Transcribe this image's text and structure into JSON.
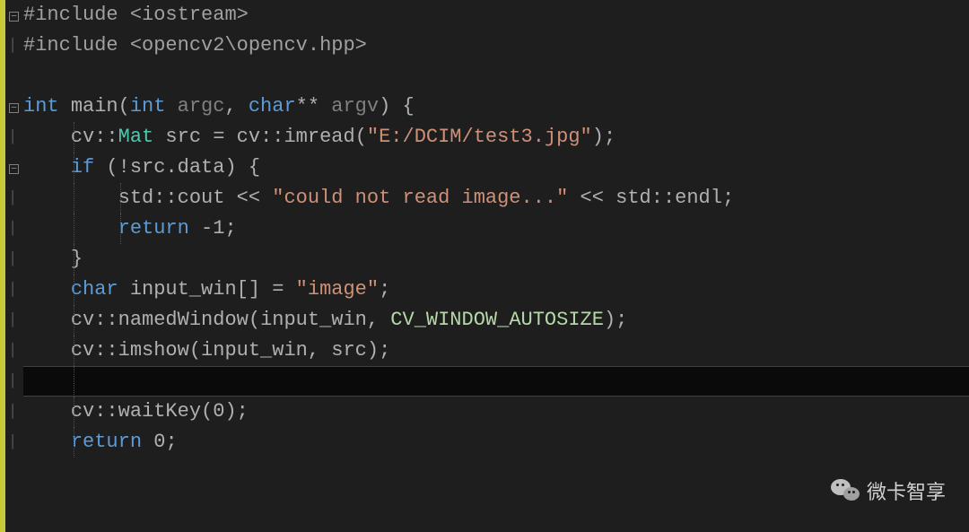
{
  "code": {
    "lines": [
      {
        "fold": "collapse",
        "indent": 0,
        "segments": [
          {
            "cls": "preprocessor",
            "text": "#include "
          },
          {
            "cls": "include-path",
            "text": "<iostream>"
          }
        ]
      },
      {
        "fold": "pipe",
        "indent": 0,
        "segments": [
          {
            "cls": "preprocessor",
            "text": "#include "
          },
          {
            "cls": "include-path",
            "text": "<opencv2\\opencv.hpp>"
          }
        ]
      },
      {
        "fold": "",
        "indent": 0,
        "segments": []
      },
      {
        "fold": "collapse",
        "indent": 0,
        "segments": [
          {
            "cls": "keyword-type",
            "text": "int"
          },
          {
            "cls": "punct",
            "text": " "
          },
          {
            "cls": "identifier",
            "text": "main"
          },
          {
            "cls": "paren",
            "text": "("
          },
          {
            "cls": "keyword-type",
            "text": "int"
          },
          {
            "cls": "param",
            "text": " argc"
          },
          {
            "cls": "punct",
            "text": ", "
          },
          {
            "cls": "keyword-type",
            "text": "char"
          },
          {
            "cls": "operator",
            "text": "**"
          },
          {
            "cls": "param",
            "text": " argv"
          },
          {
            "cls": "paren",
            "text": ") "
          },
          {
            "cls": "punct",
            "text": "{"
          }
        ]
      },
      {
        "fold": "pipe",
        "indent": 1,
        "segments": [
          {
            "cls": "namespace",
            "text": "cv"
          },
          {
            "cls": "punct",
            "text": "::"
          },
          {
            "cls": "class-name",
            "text": "Mat"
          },
          {
            "cls": "identifier",
            "text": " src "
          },
          {
            "cls": "operator",
            "text": "="
          },
          {
            "cls": "identifier",
            "text": " cv"
          },
          {
            "cls": "punct",
            "text": "::"
          },
          {
            "cls": "func",
            "text": "imread"
          },
          {
            "cls": "paren",
            "text": "("
          },
          {
            "cls": "string",
            "text": "\"E:/DCIM/test3.jpg\""
          },
          {
            "cls": "paren",
            "text": ")"
          },
          {
            "cls": "punct",
            "text": ";"
          }
        ]
      },
      {
        "fold": "collapse-nested",
        "indent": 1,
        "segments": [
          {
            "cls": "keyword",
            "text": "if"
          },
          {
            "cls": "punct",
            "text": " "
          },
          {
            "cls": "paren",
            "text": "("
          },
          {
            "cls": "operator",
            "text": "!"
          },
          {
            "cls": "identifier",
            "text": "src"
          },
          {
            "cls": "punct",
            "text": "."
          },
          {
            "cls": "identifier",
            "text": "data"
          },
          {
            "cls": "paren",
            "text": ")"
          },
          {
            "cls": "punct",
            "text": " {"
          }
        ]
      },
      {
        "fold": "pipe-nested",
        "indent": 2,
        "segments": [
          {
            "cls": "namespace",
            "text": "std"
          },
          {
            "cls": "punct",
            "text": "::"
          },
          {
            "cls": "identifier",
            "text": "cout "
          },
          {
            "cls": "operator",
            "text": "<<"
          },
          {
            "cls": "punct",
            "text": " "
          },
          {
            "cls": "string",
            "text": "\"could not read image...\""
          },
          {
            "cls": "punct",
            "text": " "
          },
          {
            "cls": "operator",
            "text": "<<"
          },
          {
            "cls": "punct",
            "text": " "
          },
          {
            "cls": "namespace",
            "text": "std"
          },
          {
            "cls": "punct",
            "text": "::"
          },
          {
            "cls": "identifier",
            "text": "endl"
          },
          {
            "cls": "punct",
            "text": ";"
          }
        ]
      },
      {
        "fold": "pipe-nested",
        "indent": 2,
        "segments": [
          {
            "cls": "keyword",
            "text": "return"
          },
          {
            "cls": "punct",
            "text": " "
          },
          {
            "cls": "operator",
            "text": "-"
          },
          {
            "cls": "number",
            "text": "1"
          },
          {
            "cls": "punct",
            "text": ";"
          }
        ]
      },
      {
        "fold": "pipe",
        "indent": 1,
        "segments": [
          {
            "cls": "punct",
            "text": "}"
          }
        ]
      },
      {
        "fold": "pipe",
        "indent": 1,
        "segments": [
          {
            "cls": "keyword-type",
            "text": "char"
          },
          {
            "cls": "identifier",
            "text": " input_win"
          },
          {
            "cls": "paren",
            "text": "[]"
          },
          {
            "cls": "punct",
            "text": " "
          },
          {
            "cls": "operator",
            "text": "="
          },
          {
            "cls": "punct",
            "text": " "
          },
          {
            "cls": "string",
            "text": "\"image\""
          },
          {
            "cls": "punct",
            "text": ";"
          }
        ]
      },
      {
        "fold": "pipe",
        "indent": 1,
        "segments": [
          {
            "cls": "namespace",
            "text": "cv"
          },
          {
            "cls": "punct",
            "text": "::"
          },
          {
            "cls": "func",
            "text": "namedWindow"
          },
          {
            "cls": "paren",
            "text": "("
          },
          {
            "cls": "identifier",
            "text": "input_win"
          },
          {
            "cls": "punct",
            "text": ", "
          },
          {
            "cls": "macro",
            "text": "CV_WINDOW_AUTOSIZE"
          },
          {
            "cls": "paren",
            "text": ")"
          },
          {
            "cls": "punct",
            "text": ";"
          }
        ]
      },
      {
        "fold": "pipe",
        "indent": 1,
        "segments": [
          {
            "cls": "namespace",
            "text": "cv"
          },
          {
            "cls": "punct",
            "text": "::"
          },
          {
            "cls": "func",
            "text": "imshow"
          },
          {
            "cls": "paren",
            "text": "("
          },
          {
            "cls": "identifier",
            "text": "input_win"
          },
          {
            "cls": "punct",
            "text": ", "
          },
          {
            "cls": "identifier",
            "text": "src"
          },
          {
            "cls": "paren",
            "text": ")"
          },
          {
            "cls": "punct",
            "text": ";"
          }
        ]
      },
      {
        "fold": "pipe",
        "indent": 1,
        "cursor": true,
        "segments": []
      },
      {
        "fold": "pipe",
        "indent": 1,
        "segments": [
          {
            "cls": "namespace",
            "text": "cv"
          },
          {
            "cls": "punct",
            "text": "::"
          },
          {
            "cls": "func",
            "text": "waitKey"
          },
          {
            "cls": "paren",
            "text": "("
          },
          {
            "cls": "number",
            "text": "0"
          },
          {
            "cls": "paren",
            "text": ")"
          },
          {
            "cls": "punct",
            "text": ";"
          }
        ]
      },
      {
        "fold": "pipe",
        "indent": 1,
        "segments": [
          {
            "cls": "keyword",
            "text": "return"
          },
          {
            "cls": "punct",
            "text": " "
          },
          {
            "cls": "number",
            "text": "0"
          },
          {
            "cls": "punct",
            "text": ";"
          }
        ]
      }
    ]
  },
  "watermark": {
    "text": "微卡智享"
  },
  "indent_size": "    "
}
